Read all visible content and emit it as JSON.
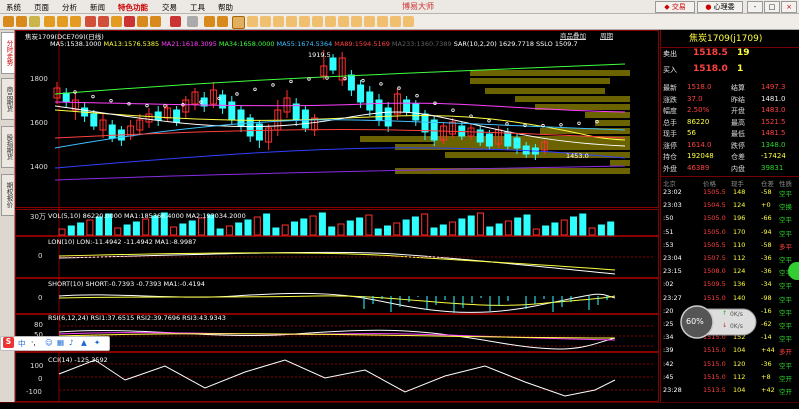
{
  "menu": {
    "items": [
      "系统",
      "页面",
      "分析",
      "新闻",
      "特色功能",
      "交易",
      "工具",
      "帮助"
    ],
    "app_title": "博易大师",
    "trade_btn": "交易",
    "login_btn": "心理委",
    "win_min": "-",
    "win_max": "□",
    "win_close": "×"
  },
  "sidebar": {
    "tabs": [
      "分时走势",
      "商品期货",
      "股指期货",
      "期权报价"
    ]
  },
  "chart": {
    "title": "焦炭1709(DCE709)(日线)",
    "tabs": [
      "商品叠加",
      "周期"
    ],
    "ma_line": [
      {
        "text": "MA5:1538.1000",
        "color": "#ffffff"
      },
      {
        "text": "MA13:1576.5385",
        "color": "#ffff40"
      },
      {
        "text": "MA21:1618.3095",
        "color": "#ff40ff"
      },
      {
        "text": "MA34:1658.0000",
        "color": "#40ff40"
      },
      {
        "text": "MA55:1674.5364",
        "color": "#40c0ff"
      },
      {
        "text": "MA89:1594.5169",
        "color": "#ff4040"
      },
      {
        "text": "MA233:1360.7389",
        "color": "#606060"
      },
      {
        "text": "SAR(10,2,20)  1629.7718",
        "color": "#ffffff"
      },
      {
        "text": "SSLO 1509.7",
        "color": "#ffffff"
      }
    ],
    "y_labels": [
      "1800",
      "1600",
      "1400"
    ],
    "high_label": "1919.5",
    "low_label": "1453.0",
    "vol": {
      "text": "VOL(5,10) 86220.0000  MA1:185366.4000  MA2:193034.2000",
      "scale": "30万"
    },
    "lon": {
      "text": "LON(10) LON:-11.4942  -11.4942  MA1:-8.9987",
      "zero": "0"
    },
    "short": {
      "text": "SHORT(10) SHORT:-0.7393  -0.7393  MA1:-0.4194",
      "zero": "0"
    },
    "rsi": {
      "text": "RSI(6,12,24) RSI1:37.6515  RSI2:39.7696  RSI3:43.9343",
      "ticks": [
        "80",
        "50",
        "20"
      ]
    },
    "cci": {
      "text": "CCI(14)  -125.3592",
      "ticks": [
        "100",
        "0",
        "-100"
      ]
    }
  },
  "quote": {
    "name": "焦炭1709(j1709)",
    "ask_label": "卖出",
    "ask": "1518.5",
    "ask_vol": "19",
    "bid_label": "买入",
    "bid": "1518.0",
    "bid_vol": "1",
    "rows": [
      {
        "l1": "最新",
        "v1": "1518.0",
        "c1": "#ff4040",
        "l2": "结算",
        "v2": "1497.3",
        "c2": "#ff4040"
      },
      {
        "l1": "涨跌",
        "v1": "37.0",
        "c1": "#ff4040",
        "l2": "昨结",
        "v2": "1481.0",
        "c2": "#eeeeee"
      },
      {
        "l1": "幅度",
        "v1": "2.50%",
        "c1": "#ff4040",
        "l2": "开盘",
        "v2": "1483.0",
        "c2": "#ff4040"
      },
      {
        "l1": "总手",
        "v1": "86220",
        "c1": "#ffff40",
        "l2": "最高",
        "v2": "1521.5",
        "c2": "#ff4040"
      },
      {
        "l1": "现手",
        "v1": "56",
        "c1": "#ffff40",
        "l2": "最低",
        "v2": "1481.5",
        "c2": "#ff4040"
      },
      {
        "l1": "涨停",
        "v1": "1614.0",
        "c1": "#ff4040",
        "l2": "跌停",
        "v2": "1348.0",
        "c2": "#2bd42b"
      },
      {
        "l1": "持仓",
        "v1": "192048",
        "c1": "#ffff40",
        "l2": "仓差",
        "v2": "-17424",
        "c2": "#ffff40"
      },
      {
        "l1": "外盘",
        "v1": "46389",
        "c1": "#ff4040",
        "l2": "内盘",
        "v2": "39831",
        "c2": "#2bd42b"
      }
    ],
    "tick_header": {
      "city": "北京",
      "price": "价格",
      "vol": "现手",
      "oi": "仓差",
      "nature": "性质"
    },
    "ticks": [
      {
        "t": "23:02",
        "p": "1505.5",
        "v": "148",
        "oi": "-58",
        "n": "空平",
        "nc": "#2bd42b"
      },
      {
        "t": "23:03",
        "p": "1504.5",
        "v": "124",
        "oi": "+0",
        "n": "空换",
        "nc": "#2bd42b"
      },
      {
        "t": ":50",
        "p": "1505.0",
        "v": "196",
        "oi": "-66",
        "n": "空平",
        "nc": "#2bd42b"
      },
      {
        "t": ":51",
        "p": "1505.0",
        "v": "170",
        "oi": "-94",
        "n": "空平",
        "nc": "#2bd42b"
      },
      {
        "t": ":53",
        "p": "1505.5",
        "v": "110",
        "oi": "-58",
        "n": "多平",
        "nc": "#ff4040"
      },
      {
        "t": "23:04",
        "p": "1507.5",
        "v": "112",
        "oi": "-36",
        "n": "空平",
        "nc": "#2bd42b"
      },
      {
        "t": "23:15",
        "p": "1508.0",
        "v": "124",
        "oi": "-36",
        "n": "空平",
        "nc": "#2bd42b"
      },
      {
        "t": ":02",
        "p": "1509.5",
        "v": "136",
        "oi": "-34",
        "n": "空平",
        "nc": "#2bd42b"
      },
      {
        "t": "23:27",
        "p": "1515.0",
        "v": "140",
        "oi": "-98",
        "n": "空平",
        "nc": "#2bd42b"
      },
      {
        "t": ":20",
        "p": "1515.0",
        "v": "188",
        "oi": "-16",
        "n": "空平",
        "nc": "#2bd42b"
      },
      {
        "t": ":25",
        "p": "1515.0",
        "v": "112",
        "oi": "-62",
        "n": "空平",
        "nc": "#2bd42b"
      },
      {
        "t": ":34",
        "p": "1515.0",
        "v": "152",
        "oi": "-14",
        "n": "空平",
        "nc": "#2bd42b"
      },
      {
        "t": ":39",
        "p": "1515.0",
        "v": "104",
        "oi": "+44",
        "n": "多开",
        "nc": "#ff4040"
      },
      {
        "t": ":42",
        "p": "1515.0",
        "v": "120",
        "oi": "-36",
        "n": "空平",
        "nc": "#2bd42b"
      },
      {
        "t": ":45",
        "p": "1515.0",
        "v": "112",
        "oi": "+8",
        "n": "空开",
        "nc": "#2bd42b"
      },
      {
        "t": "23:28",
        "p": "1513.5",
        "v": "104",
        "oi": "+42",
        "n": "空开",
        "nc": "#2bd42b"
      }
    ]
  },
  "speed": {
    "pct": "60%",
    "up": "0K/s",
    "down": "0K/s"
  },
  "ime": {
    "logo": "S",
    "lang": "中",
    "punct": "·,"
  }
}
